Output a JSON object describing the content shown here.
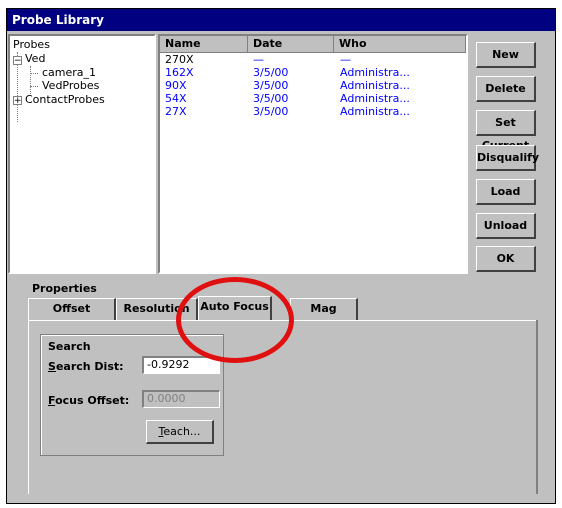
{
  "window": {
    "title": "Probe Library"
  },
  "tree": {
    "root": "Probes",
    "nodes": [
      {
        "label": "Ved",
        "expander": "−"
      },
      {
        "label": "camera_1"
      },
      {
        "label": "VedProbes"
      },
      {
        "label": "ContactProbes",
        "expander": "+"
      }
    ]
  },
  "list": {
    "columns": [
      "Name",
      "Date",
      "Who"
    ],
    "rows": [
      {
        "name": "270X",
        "date": "—",
        "who": "—"
      },
      {
        "name": "162X",
        "date": "3/5/00",
        "who": "Administra..."
      },
      {
        "name": "90X",
        "date": "3/5/00",
        "who": "Administra..."
      },
      {
        "name": "54X",
        "date": "3/5/00",
        "who": "Administra..."
      },
      {
        "name": "27X",
        "date": "3/5/00",
        "who": "Administra..."
      }
    ]
  },
  "buttons": {
    "new": "New",
    "delete": "Delete",
    "set_current": "Set Current",
    "disqualify": "Disqualify",
    "load": "Load",
    "unload": "Unload",
    "ok": "OK"
  },
  "properties": {
    "label": "Properties",
    "tabs": [
      "Offset",
      "Resolution",
      "Auto Focus",
      "Mag"
    ],
    "active_tab": "Auto Focus",
    "search": {
      "group_label": "Search",
      "search_dist_label_u": "S",
      "search_dist_label_rest": "earch Dist:",
      "search_dist_value": "-0.9292",
      "focus_offset_label_u": "F",
      "focus_offset_label_rest": "ocus Offset:",
      "focus_offset_value": "0.0000",
      "teach_label_u": "T",
      "teach_label_rest": "each..."
    }
  },
  "colors": {
    "title_bar": "#000080",
    "list_text": "#0000ff",
    "highlight_circle": "#e01010"
  }
}
